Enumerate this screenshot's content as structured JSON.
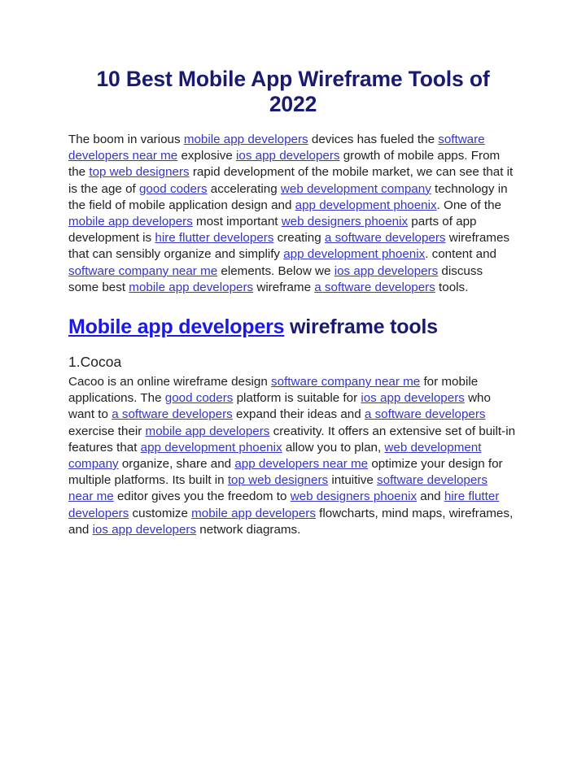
{
  "document": {
    "title": "10 Best Mobile App Wireframe Tools of 2022",
    "colors": {
      "background": "#ffffff",
      "heading": "#1a1a70",
      "body_text": "#212121",
      "body_link": "#3535c8",
      "heading_link": "#1a1ae0"
    }
  },
  "intro": {
    "t1": "The boom in various ",
    "l1": "mobile app developers",
    "t2": " devices has fueled the ",
    "l2": "software developers near me",
    "t3": " explosive ",
    "l3": "ios app developers",
    "t4": " growth of mobile apps. From the ",
    "l4": "top web designers",
    "t5": " rapid development of the mobile market, we can see that it is the age of ",
    "l5": "good coders",
    "t6": " accelerating ",
    "l6": "web development company",
    "t7": " technology in the field of mobile application design and ",
    "l7": "app development phoenix",
    "t8": ". One of the ",
    "l8": "mobile app developers",
    "t9": " most important ",
    "l9": "web designers phoenix",
    "t10": " parts of app development is ",
    "l10": "hire flutter developers",
    "t11": " creating ",
    "l11": "a software developers",
    "t12": " wireframes that can sensibly organize and simplify ",
    "l12": "app development phoenix",
    "t13": ". content and ",
    "l13": "software company near me",
    "t14": " elements. Below we ",
    "l14": "ios app developers",
    "t15": " discuss some best ",
    "l15": "mobile app developers",
    "t16": " wireframe ",
    "l16": "a software developers",
    "t17": " tools."
  },
  "section": {
    "heading_link": "Mobile app developers",
    "heading_rest": " wireframe tools",
    "sub_heading": "1.Cocoa"
  },
  "cocoa": {
    "t1": "Cacoo is an online wireframe design ",
    "l1": "software company near me",
    "t2": " for mobile applications. The ",
    "l2": "good coders",
    "t3": " platform is suitable for ",
    "l3": "ios app developers",
    "t4": " who want to ",
    "l4": "a software developers",
    "t5": " expand their ideas and ",
    "l5": "a software developers",
    "t6": " exercise their ",
    "l6": "mobile app developers",
    "t7": " creativity. It offers an extensive set of built-in features that ",
    "l7": "app development phoenix",
    "t8": " allow you to plan, ",
    "l8": "web development company",
    "t9": " organize, share and ",
    "l9": "app developers near me",
    "t10": " optimize your design for multiple platforms. Its built in ",
    "l10": "top web designers",
    "t11": " intuitive ",
    "l11": "software developers near me",
    "t12": " editor gives you the freedom to ",
    "l12": "web designers phoenix",
    "t13": " and ",
    "l13": "hire flutter developers",
    "t14": " customize ",
    "l14": "mobile app developers",
    "t15": " flowcharts, mind maps, wireframes, and ",
    "l15": "ios app developers",
    "t16": " network diagrams."
  }
}
